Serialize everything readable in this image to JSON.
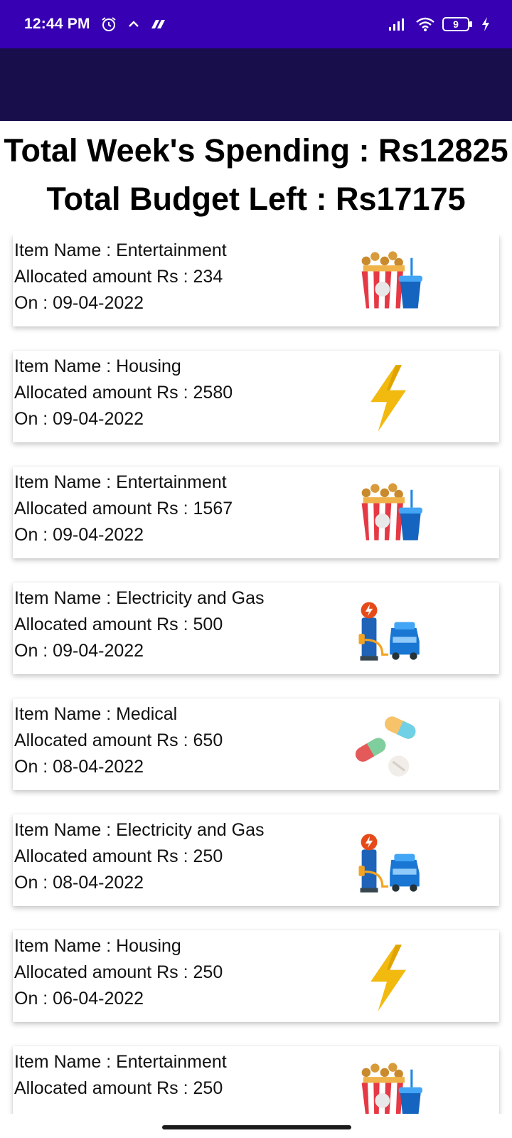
{
  "status_bar": {
    "time": "12:44 PM",
    "battery": "9",
    "icons": [
      "alarm-icon",
      "chevron-up-icon",
      "app-notification-icon",
      "signal-icon",
      "wifi-icon",
      "battery-icon",
      "charging-icon"
    ]
  },
  "summary": {
    "total_spending": "Total Week's Spending : Rs12825",
    "budget_left": "Total Budget Left : Rs17175"
  },
  "items": [
    {
      "name": "Item Name : Entertainment",
      "amount": "Allocated amount Rs : 234",
      "date": "On : 09-04-2022",
      "icon": "popcorn-icon"
    },
    {
      "name": "Item Name : Housing",
      "amount": "Allocated amount Rs : 2580",
      "date": "On : 09-04-2022",
      "icon": "lightning-icon"
    },
    {
      "name": "Item Name : Entertainment",
      "amount": "Allocated amount Rs : 1567",
      "date": "On : 09-04-2022",
      "icon": "popcorn-icon"
    },
    {
      "name": "Item Name : Electricity and Gas",
      "amount": "Allocated amount Rs : 500",
      "date": "On : 09-04-2022",
      "icon": "charging-station-icon"
    },
    {
      "name": "Item Name : Medical",
      "amount": "Allocated amount Rs : 650",
      "date": "On : 08-04-2022",
      "icon": "pills-icon"
    },
    {
      "name": "Item Name : Electricity and Gas",
      "amount": "Allocated amount Rs : 250",
      "date": "On : 08-04-2022",
      "icon": "charging-station-icon"
    },
    {
      "name": "Item Name : Housing",
      "amount": "Allocated amount Rs : 250",
      "date": "On : 06-04-2022",
      "icon": "lightning-icon"
    },
    {
      "name": "Item Name : Entertainment",
      "amount": "Allocated amount Rs : 250",
      "date": "",
      "icon": "popcorn-icon"
    }
  ],
  "colors": {
    "status_bar": "#3700b3",
    "app_bar": "#170e4b",
    "background": "#ffffff"
  }
}
